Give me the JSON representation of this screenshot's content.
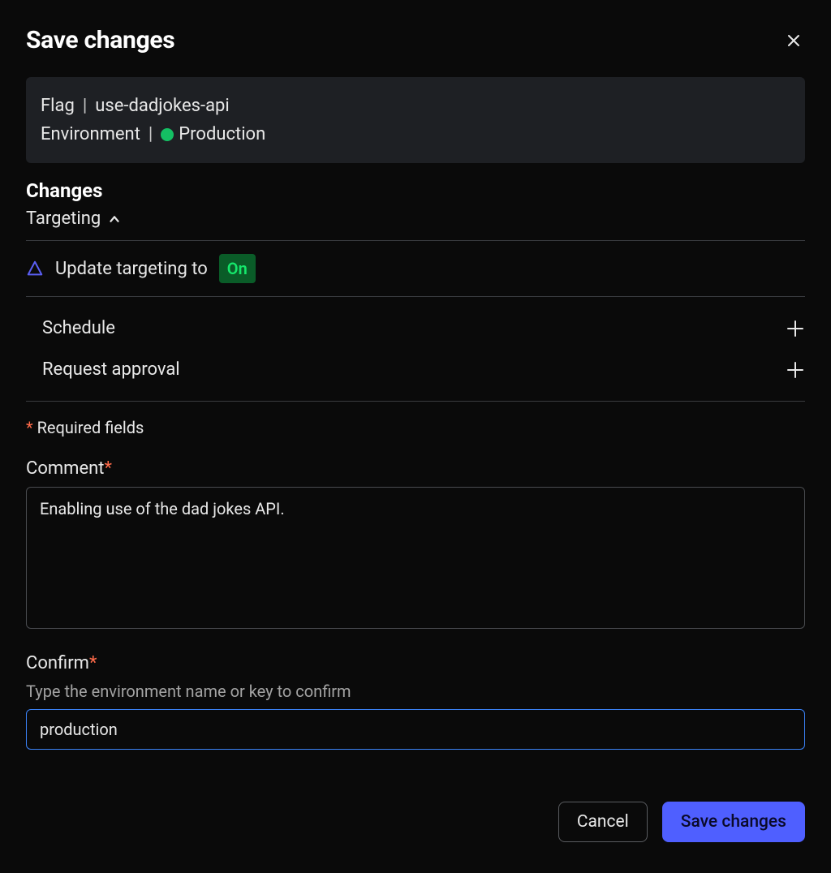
{
  "dialog": {
    "title": "Save changes"
  },
  "context": {
    "flag_label": "Flag",
    "flag_name": "use-dadjokes-api",
    "env_label": "Environment",
    "env_name": "Production",
    "env_color": "#14bf63"
  },
  "changes": {
    "heading": "Changes",
    "targeting_label": "Targeting",
    "update_text": "Update targeting to",
    "update_state": "On"
  },
  "options": {
    "schedule": "Schedule",
    "request_approval": "Request approval"
  },
  "required_note": "Required fields",
  "comment": {
    "label": "Comment",
    "value": "Enabling use of the dad jokes API."
  },
  "confirm": {
    "label": "Confirm",
    "help": "Type the environment name or key to confirm",
    "value": "production"
  },
  "buttons": {
    "cancel": "Cancel",
    "save": "Save changes"
  }
}
